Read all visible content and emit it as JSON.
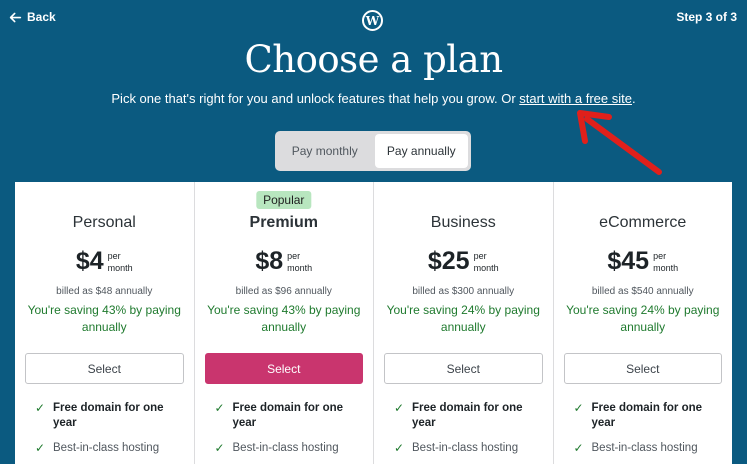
{
  "header": {
    "back_label": "Back",
    "logo_letter": "W",
    "step_label": "Step 3 of 3"
  },
  "hero": {
    "title": "Choose a plan",
    "subtitle_text": "Pick one that's right for you and unlock features that help you grow. Or ",
    "subtitle_link": "start with a free site",
    "subtitle_end": "."
  },
  "billing_toggle": {
    "monthly_label": "Pay monthly",
    "annually_label": "Pay annually",
    "selected": "annually"
  },
  "plans": [
    {
      "name": "Personal",
      "badge": "",
      "price": "$4",
      "per_line1": "per",
      "per_line2": "month",
      "billed": "billed as $48 annually",
      "saving": "You're saving 43% by paying annually",
      "select_label": "Select",
      "features": [
        {
          "text": "Free domain for one year",
          "bold": true
        },
        {
          "text": "Best-in-class hosting",
          "bold": false
        }
      ]
    },
    {
      "name": "Premium",
      "badge": "Popular",
      "price": "$8",
      "per_line1": "per",
      "per_line2": "month",
      "billed": "billed as $96 annually",
      "saving": "You're saving 43% by paying annually",
      "select_label": "Select",
      "features": [
        {
          "text": "Free domain for one year",
          "bold": true
        },
        {
          "text": "Best-in-class hosting",
          "bold": false
        }
      ]
    },
    {
      "name": "Business",
      "badge": "",
      "price": "$25",
      "per_line1": "per",
      "per_line2": "month",
      "billed": "billed as $300 annually",
      "saving": "You're saving 24% by paying annually",
      "select_label": "Select",
      "features": [
        {
          "text": "Free domain for one year",
          "bold": true
        },
        {
          "text": "Best-in-class hosting",
          "bold": false
        }
      ]
    },
    {
      "name": "eCommerce",
      "badge": "",
      "price": "$45",
      "per_line1": "per",
      "per_line2": "month",
      "billed": "billed as $540 annually",
      "saving": "You're saving 24% by paying annually",
      "select_label": "Select",
      "features": [
        {
          "text": "Free domain for one year",
          "bold": true
        },
        {
          "text": "Best-in-class hosting",
          "bold": false
        }
      ]
    }
  ],
  "colors": {
    "background": "#0b5a80",
    "primary_button": "#c9356e",
    "saving_text": "#1f7a2e",
    "badge": "#b8e6bf",
    "annotation_arrow": "#e0201b"
  },
  "icons": {
    "back": "arrow-left-icon",
    "logo": "wordpress-logo-icon",
    "check": "check-icon",
    "annotation": "red-arrow-annotation"
  }
}
